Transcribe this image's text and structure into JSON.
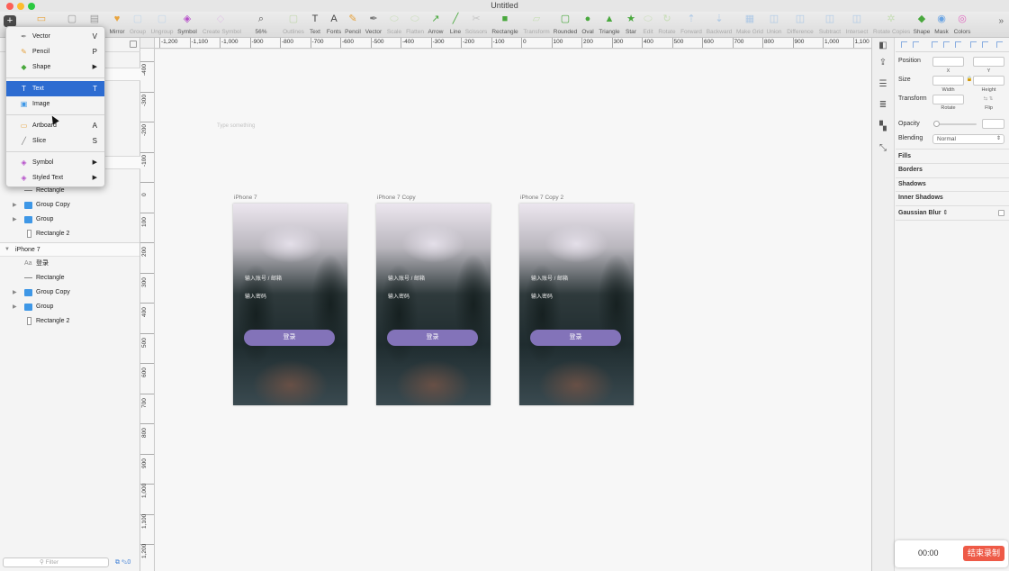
{
  "window": {
    "title": "Untitled"
  },
  "toolbar": {
    "insert_icon": "plus-icon",
    "items": [
      {
        "label": "",
        "icon": "artboard-icon",
        "color": "#e7a23a",
        "dim": false
      },
      {
        "label": "",
        "icon": "page-icon",
        "color": "#9a9a9a",
        "dim": false
      },
      {
        "label": "",
        "icon": "view-icon",
        "color": "#9a9a9a",
        "dim": false
      },
      {
        "label": "Mirror",
        "icon": "mirror-icon",
        "color": "#e8a33d",
        "dim": false
      },
      {
        "label": "Group",
        "icon": "group-icon",
        "color": "#9ac3ea",
        "dim": true
      },
      {
        "label": "Ungroup",
        "icon": "ungroup-icon",
        "color": "#9ac3ea",
        "dim": true
      },
      {
        "label": "Symbol",
        "icon": "symbol-icon",
        "color": "#b54fc9",
        "dim": false
      },
      {
        "label": "Create Symbol",
        "icon": "create-symbol-icon",
        "color": "#d9a3e4",
        "dim": true
      },
      {
        "label": "56%",
        "icon": "zoom-icon",
        "color": "#555555",
        "dim": false
      },
      {
        "label": "Outlines",
        "icon": "outlines-icon",
        "color": "#94c46a",
        "dim": true
      },
      {
        "label": "Text",
        "icon": "text-icon",
        "color": "#444444",
        "dim": false
      },
      {
        "label": "Fonts",
        "icon": "fonts-icon",
        "color": "#444444",
        "dim": false
      },
      {
        "label": "Pencil",
        "icon": "pencil-icon",
        "color": "#e5a13c",
        "dim": false
      },
      {
        "label": "Vector",
        "icon": "vector-icon",
        "color": "#777777",
        "dim": false
      },
      {
        "label": "Scale",
        "icon": "scale-icon",
        "color": "#9fd07a",
        "dim": true
      },
      {
        "label": "Flatten",
        "icon": "flatten-icon",
        "color": "#9fd07a",
        "dim": true
      },
      {
        "label": "Arrow",
        "icon": "arrow-icon",
        "color": "#49a83d",
        "dim": false
      },
      {
        "label": "Line",
        "icon": "line-icon",
        "color": "#49a83d",
        "dim": false
      },
      {
        "label": "Scissors",
        "icon": "scissors-icon",
        "color": "#9a9a9a",
        "dim": true
      },
      {
        "label": "Rectangle",
        "icon": "rectangle-icon",
        "color": "#49a83d",
        "dim": false
      },
      {
        "label": "Transform",
        "icon": "transform-icon",
        "color": "#9fd07a",
        "dim": true
      },
      {
        "label": "Rounded",
        "icon": "rounded-rect-icon",
        "color": "#49a83d",
        "dim": false
      },
      {
        "label": "Oval",
        "icon": "oval-icon",
        "color": "#49a83d",
        "dim": false
      },
      {
        "label": "Triangle",
        "icon": "triangle-icon",
        "color": "#49a83d",
        "dim": false
      },
      {
        "label": "Star",
        "icon": "star-icon",
        "color": "#49a83d",
        "dim": false
      },
      {
        "label": "Edit",
        "icon": "edit-icon",
        "color": "#9fd07a",
        "dim": true
      },
      {
        "label": "Rotate",
        "icon": "rotate-icon",
        "color": "#9fd07a",
        "dim": true
      },
      {
        "label": "Forward",
        "icon": "forward-icon",
        "color": "#6aa4e3",
        "dim": true
      },
      {
        "label": "Backward",
        "icon": "backward-icon",
        "color": "#6aa4e3",
        "dim": true
      },
      {
        "label": "Make Grid",
        "icon": "make-grid-icon",
        "color": "#6aa4e3",
        "dim": true
      },
      {
        "label": "Union",
        "icon": "union-icon",
        "color": "#6aa4e3",
        "dim": true
      },
      {
        "label": "Difference",
        "icon": "difference-icon",
        "color": "#6aa4e3",
        "dim": true
      },
      {
        "label": "Subtract",
        "icon": "subtract-icon",
        "color": "#6aa4e3",
        "dim": true
      },
      {
        "label": "Intersect",
        "icon": "intersect-icon",
        "color": "#6aa4e3",
        "dim": true
      },
      {
        "label": "Rotate Copies",
        "icon": "rotate-copies-icon",
        "color": "#9fd07a",
        "dim": true
      },
      {
        "label": "Shape",
        "icon": "shape-icon",
        "color": "#49a83d",
        "dim": false
      },
      {
        "label": "Mask",
        "icon": "mask-icon",
        "color": "#6aa4e3",
        "dim": false
      },
      {
        "label": "Colors",
        "icon": "colors-icon",
        "color": "#e06ac0",
        "dim": false
      }
    ]
  },
  "insert_menu": {
    "items": [
      {
        "label": "Vector",
        "shortcut": "V",
        "icon": "vector-icon",
        "color": "#8a8a8a"
      },
      {
        "label": "Pencil",
        "shortcut": "P",
        "icon": "pencil-icon",
        "color": "#e5a13c"
      },
      {
        "label": "Shape",
        "submenu": "▶",
        "icon": "shape-icon",
        "color": "#49a83d"
      },
      {
        "label": "Text",
        "shortcut": "T",
        "icon": "text-icon",
        "color": "#ffffff",
        "active": true
      },
      {
        "label": "Image",
        "icon": "image-icon",
        "color": "#3e97e6"
      },
      {
        "label": "Artboard",
        "shortcut": "A",
        "icon": "artboard-icon",
        "color": "#e7a23a"
      },
      {
        "label": "Slice",
        "shortcut": "S",
        "icon": "slice-icon",
        "color": "#777777"
      },
      {
        "label": "Symbol",
        "submenu": "▶",
        "icon": "symbol-icon",
        "color": "#b54fc9"
      },
      {
        "label": "Styled Text",
        "submenu": "▶",
        "icon": "styled-text-icon",
        "color": "#b54fc9"
      }
    ]
  },
  "layers": {
    "upper": [
      {
        "name": "Rectangle",
        "kind": "line"
      },
      {
        "name": "Group Copy",
        "kind": "folder"
      },
      {
        "name": "Group",
        "kind": "folder"
      },
      {
        "name": "Rectangle 2",
        "kind": "rect"
      }
    ],
    "iphone7_group": {
      "name": "iPhone 7",
      "arrow": "▼"
    },
    "lower": [
      {
        "name": "登录",
        "kind": "text",
        "icon_text": "Aa"
      },
      {
        "name": "Rectangle",
        "kind": "line"
      },
      {
        "name": "Group Copy",
        "kind": "folder"
      },
      {
        "name": "Group",
        "kind": "folder"
      },
      {
        "name": "Rectangle 2",
        "kind": "rect"
      }
    ],
    "filter_placeholder": "Filter",
    "filter_icons": "⧉ ✎0"
  },
  "rulers": {
    "h_labels": [
      "-1,200",
      "-1,100",
      "-1,000",
      "-900",
      "-800",
      "-700",
      "-600",
      "-500",
      "-400",
      "-300",
      "-200",
      "-100",
      "0",
      "100",
      "200",
      "300",
      "400",
      "500",
      "600",
      "700",
      "800",
      "900",
      "1,000",
      "1,100"
    ],
    "v_labels": [
      "-400",
      "-300",
      "-200",
      "-100",
      "0",
      "100",
      "200",
      "300",
      "400",
      "500",
      "600",
      "700",
      "800",
      "900",
      "1,000",
      "1,100",
      "1,200"
    ]
  },
  "canvas": {
    "placeholder_text": "Type something",
    "artboards": [
      {
        "name": "iPhone 7",
        "account_placeholder": "输入账号 / 邮箱",
        "password_placeholder": "输入密码",
        "login_label": "登录"
      },
      {
        "name": "iPhone 7 Copy",
        "account_placeholder": "输入账号 / 邮箱",
        "password_placeholder": "输入密码",
        "login_label": "登录"
      },
      {
        "name": "iPhone 7 Copy 2",
        "account_placeholder": "输入账号 / 邮箱",
        "password_placeholder": "输入密码",
        "login_label": "登录"
      }
    ],
    "button_color": "#8373b9"
  },
  "inspector": {
    "position_label": "Position",
    "x_label": "X",
    "y_label": "Y",
    "size_label": "Size",
    "width_label": "Width",
    "height_label": "Height",
    "transform_label": "Transform",
    "rotate_label": "Rotate",
    "flip_label": "Flip",
    "opacity_label": "Opacity",
    "blending_label": "Blending",
    "blending_value": "Normal",
    "fills_label": "Fills",
    "borders_label": "Borders",
    "shadows_label": "Shadows",
    "inner_shadows_label": "Inner Shadows",
    "gaussian_blur_label": "Gaussian Blur"
  },
  "recording": {
    "time": "00:00",
    "stop_label": "结束录制",
    "color": "#ee5a47"
  }
}
